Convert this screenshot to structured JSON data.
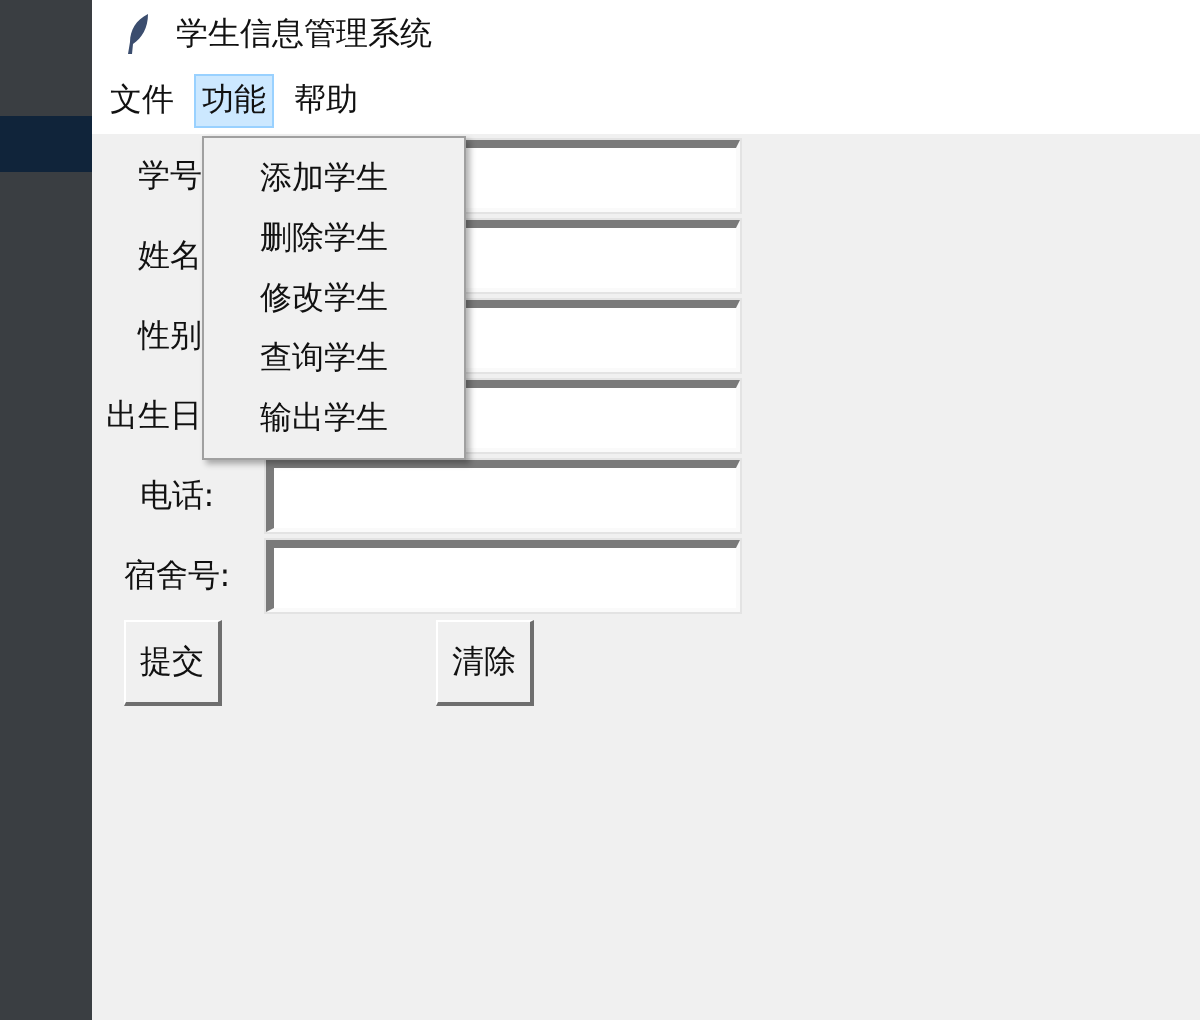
{
  "window": {
    "title": "学生信息管理系统"
  },
  "menubar": [
    {
      "label": "文件",
      "selected": false
    },
    {
      "label": "功能",
      "selected": true
    },
    {
      "label": "帮助",
      "selected": false
    }
  ],
  "dropdown": {
    "items": [
      "添加学生",
      "删除学生",
      "修改学生",
      "查询学生",
      "输出学生"
    ]
  },
  "form": {
    "fields": [
      {
        "label": "学号",
        "kind": "cut"
      },
      {
        "label": "姓名",
        "kind": "cut"
      },
      {
        "label": "性别",
        "kind": "cut"
      },
      {
        "label": "出生日",
        "kind": "cut"
      },
      {
        "label": "电话:",
        "kind": "full"
      },
      {
        "label": "宿舍号:",
        "kind": "full"
      }
    ]
  },
  "buttons": [
    "提交",
    "清除"
  ]
}
